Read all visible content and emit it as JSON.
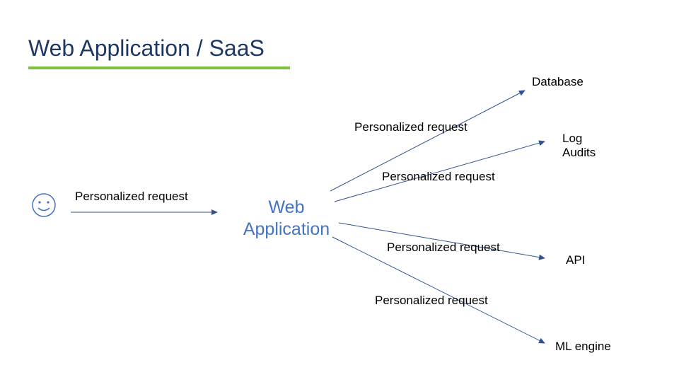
{
  "title": "Web Application / SaaS",
  "colors": {
    "title": "#1f3763",
    "underline": "#7cc242",
    "node": "#4472c4",
    "arrow": "#2f528f",
    "text": "#000000"
  },
  "user_icon": "smiley",
  "center_node": {
    "line1": "Web",
    "line2": "Application"
  },
  "edges": {
    "user_to_web": "Personalized request",
    "web_to_database": "Personalized request",
    "web_to_logs": "Personalized request",
    "web_to_api": "Personalized request",
    "web_to_ml": "Personalized request"
  },
  "targets": {
    "database": "Database",
    "log_line1": "Log",
    "log_line2": "Audits",
    "api": "API",
    "ml": "ML engine"
  }
}
